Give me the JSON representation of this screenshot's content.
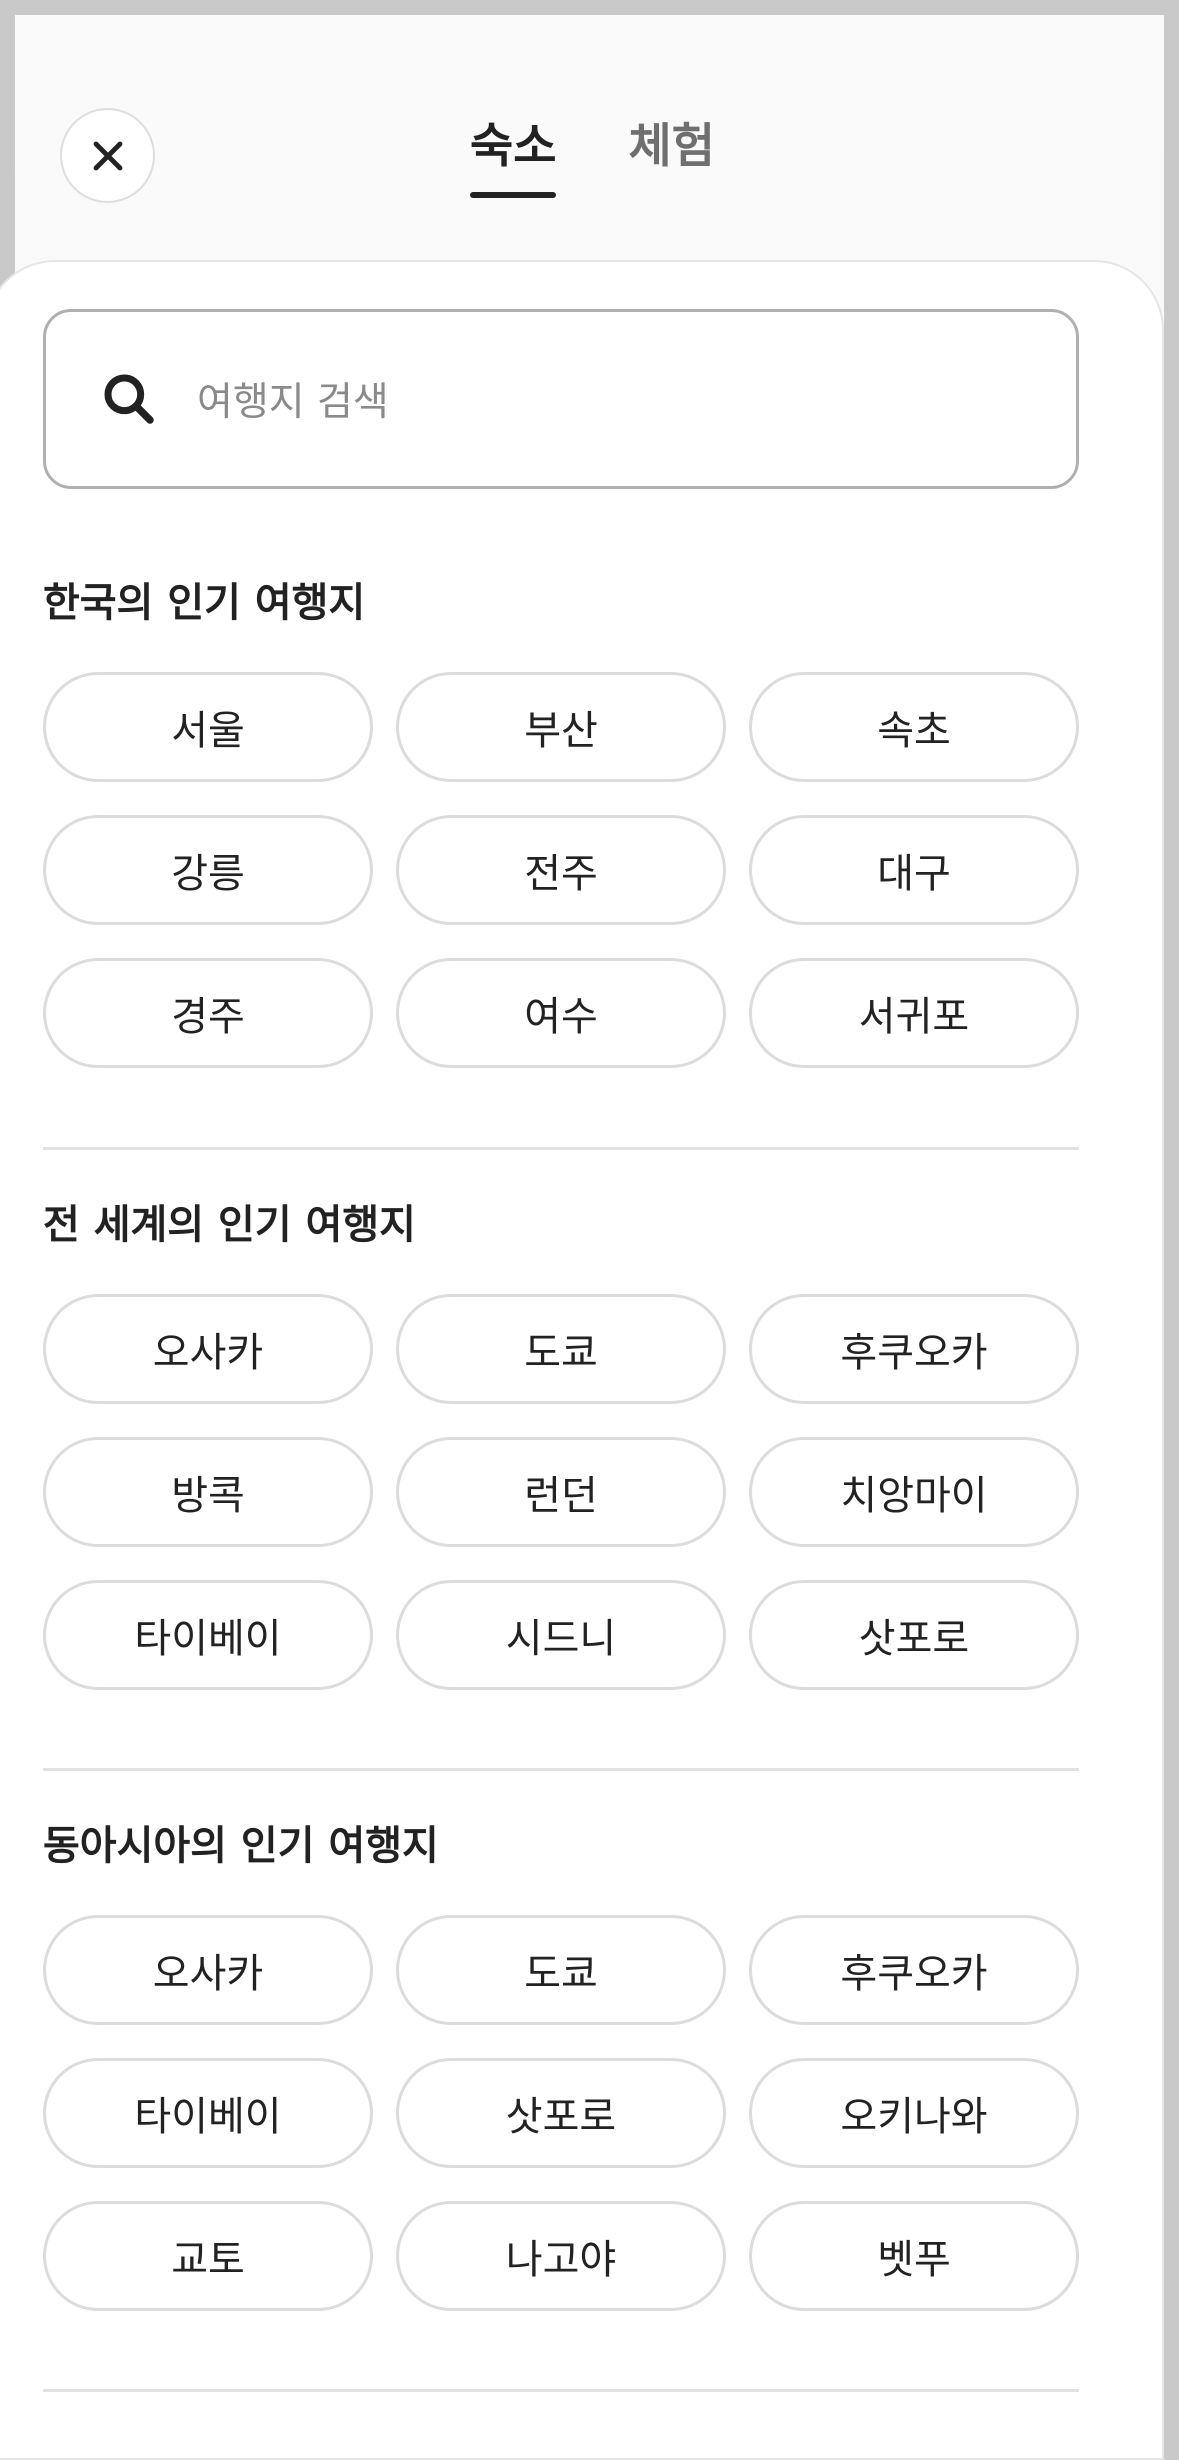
{
  "tabs": [
    {
      "label": "숙소",
      "active": true
    },
    {
      "label": "체험",
      "active": false
    }
  ],
  "search": {
    "placeholder": "여행지 검색"
  },
  "sections": [
    {
      "title": "한국의 인기 여행지",
      "items": [
        "서울",
        "부산",
        "속초",
        "강릉",
        "전주",
        "대구",
        "경주",
        "여수",
        "서귀포"
      ]
    },
    {
      "title": "전 세계의 인기 여행지",
      "items": [
        "오사카",
        "도쿄",
        "후쿠오카",
        "방콕",
        "런던",
        "치앙마이",
        "타이베이",
        "시드니",
        "삿포로"
      ]
    },
    {
      "title": "동아시아의 인기 여행지",
      "items": [
        "오사카",
        "도쿄",
        "후쿠오카",
        "타이베이",
        "삿포로",
        "오키나와",
        "교토",
        "나고야",
        "벳푸"
      ]
    }
  ],
  "icons": {
    "close": "close-icon",
    "search": "search-icon"
  }
}
